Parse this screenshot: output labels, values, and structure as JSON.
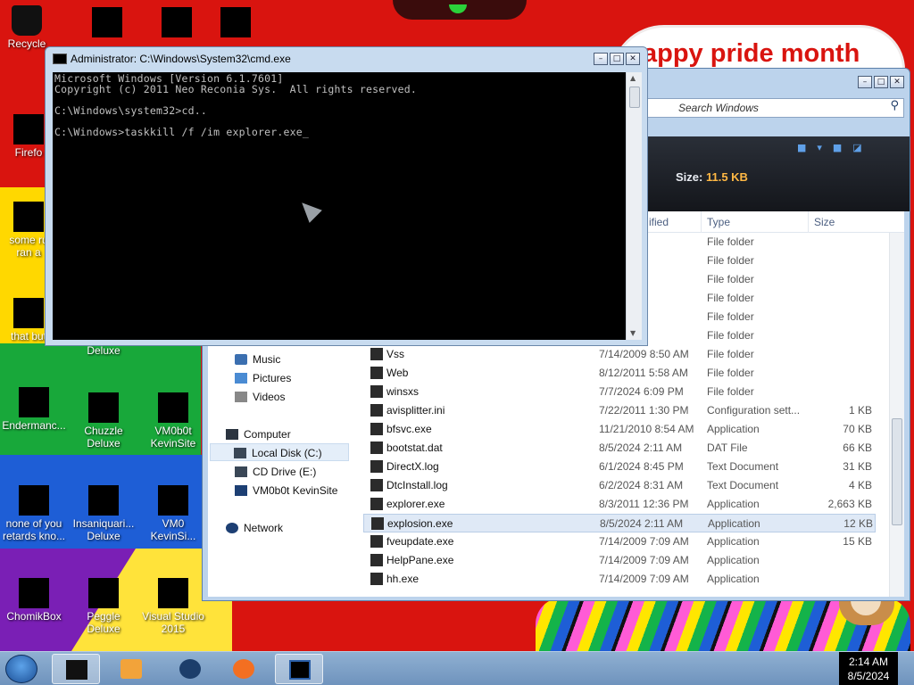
{
  "wallpaper": {
    "banner_text": "appy pride month"
  },
  "desktop_icons": [
    {
      "name": "recycle-bin",
      "label": "Recycle"
    },
    {
      "name": "firefox",
      "label": "Firefo"
    },
    {
      "name": "some-rule",
      "label": "some ru\nran a"
    },
    {
      "name": "that-but",
      "label": "that but"
    },
    {
      "name": "deluxe-hidden",
      "label": "Deluxe"
    },
    {
      "name": "endermance",
      "label": "Endermanc..."
    },
    {
      "name": "chuzzle-deluxe",
      "label": "Chuzzle\nDeluxe"
    },
    {
      "name": "vm0b0t-kevinsite-1",
      "label": "VM0b0t\nKevinSite"
    },
    {
      "name": "none-of-you",
      "label": "none of you\nretards kno..."
    },
    {
      "name": "insaniquarium-deluxe",
      "label": "Insaniquari...\nDeluxe"
    },
    {
      "name": "vm0b0t-kevinsite-2",
      "label": "VM0\nKevinSi..."
    },
    {
      "name": "chomikbox",
      "label": "ChomikBox"
    },
    {
      "name": "peggle-deluxe",
      "label": "Peggle Deluxe"
    },
    {
      "name": "visual-studio",
      "label": "Visual Studio\n2015"
    }
  ],
  "cmd": {
    "title": "Administrator: C:\\Windows\\System32\\cmd.exe",
    "lines": [
      "Microsoft Windows [Version 6.1.7601]",
      "Copyright (c) 2011 Neo Reconia Sys.  All rights reserved.",
      "",
      "C:\\Windows\\system32>cd..",
      "",
      "C:\\Windows>taskkill /f /im explorer.exe_"
    ]
  },
  "explorer": {
    "search_placeholder": "Search Windows",
    "size_label": "Size:",
    "size_value": "11.5 KB",
    "columns": {
      "modified": "ified",
      "type": "Type",
      "size": "Size"
    },
    "nav": [
      {
        "label": "Music",
        "icon": "music-icon"
      },
      {
        "label": "Pictures",
        "icon": "pictures-icon"
      },
      {
        "label": "Videos",
        "icon": "videos-icon"
      },
      {
        "label": "Computer",
        "icon": "computer-icon"
      },
      {
        "label": "Local Disk (C:)",
        "icon": "drive-icon",
        "selected": true
      },
      {
        "label": "CD Drive (E:)",
        "icon": "cd-drive-icon"
      },
      {
        "label": "VM0b0t KevinSite",
        "icon": "network-drive-icon"
      },
      {
        "label": "Network",
        "icon": "network-icon"
      }
    ],
    "files": [
      {
        "name": "",
        "date": ":09 PM",
        "type": "File folder",
        "size": ""
      },
      {
        "name": "",
        "date": "10:27 AM",
        "type": "File folder",
        "size": ""
      },
      {
        "name": "",
        "date": "10:38 AM",
        "type": "File folder",
        "size": ""
      },
      {
        "name": "",
        "date": ":12 AM",
        "type": "File folder",
        "size": ""
      },
      {
        "name": "",
        "date": "8:04 AM",
        "type": "File folder",
        "size": ""
      },
      {
        "name": "",
        "date": "11:02 AM",
        "type": "File folder",
        "size": ""
      },
      {
        "name": "Vss",
        "date": "7/14/2009 8:50 AM",
        "type": "File folder",
        "size": ""
      },
      {
        "name": "Web",
        "date": "8/12/2011 5:58 AM",
        "type": "File folder",
        "size": ""
      },
      {
        "name": "winsxs",
        "date": "7/7/2024 6:09 PM",
        "type": "File folder",
        "size": ""
      },
      {
        "name": "avisplitter.ini",
        "date": "7/22/2011 1:30 PM",
        "type": "Configuration sett...",
        "size": "1 KB"
      },
      {
        "name": "bfsvc.exe",
        "date": "11/21/2010 8:54 AM",
        "type": "Application",
        "size": "70 KB"
      },
      {
        "name": "bootstat.dat",
        "date": "8/5/2024 2:11 AM",
        "type": "DAT File",
        "size": "66 KB"
      },
      {
        "name": "DirectX.log",
        "date": "6/1/2024 8:45 PM",
        "type": "Text Document",
        "size": "31 KB"
      },
      {
        "name": "DtcInstall.log",
        "date": "6/2/2024 8:31 AM",
        "type": "Text Document",
        "size": "4 KB"
      },
      {
        "name": "explorer.exe",
        "date": "8/3/2011 12:36 PM",
        "type": "Application",
        "size": "2,663 KB"
      },
      {
        "name": "explosion.exe",
        "date": "8/5/2024 2:11 AM",
        "type": "Application",
        "size": "12 KB",
        "selected": true
      },
      {
        "name": "fveupdate.exe",
        "date": "7/14/2009 7:09 AM",
        "type": "Application",
        "size": "15 KB"
      },
      {
        "name": "HelpPane.exe",
        "date": "7/14/2009 7:09 AM",
        "type": "Application",
        "size": ""
      },
      {
        "name": "hh.exe",
        "date": "7/14/2009 7:09 AM",
        "type": "Application",
        "size": ""
      }
    ]
  },
  "taskbar": {
    "time": "2:14 AM",
    "date": "8/5/2024"
  },
  "colors": {
    "wallpaper_red": "#d9140f",
    "cmd_bg": "#000000",
    "cmd_text": "#c0c0c0",
    "taskbar": "#7fa3c9"
  }
}
